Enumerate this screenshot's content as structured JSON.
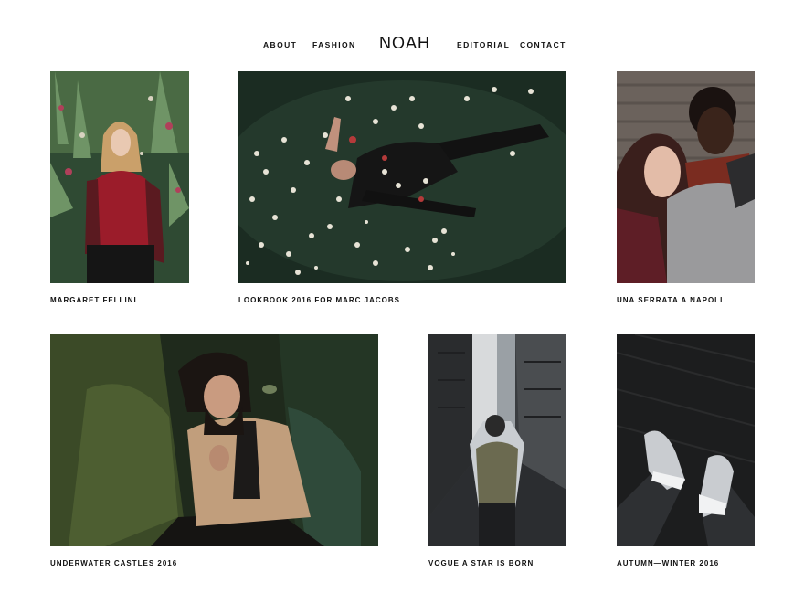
{
  "nav": {
    "items_left": [
      "ABOUT",
      "FASHION"
    ],
    "logo": "NOAH",
    "items_right": [
      "EDITORIAL",
      "CONTACT"
    ]
  },
  "gallery": [
    {
      "caption": "MARGARET FELLINI",
      "image": "woman-in-garden-photo"
    },
    {
      "caption": "LOOKBOOK 2016 FOR MARC JACOBS",
      "image": "woman-floating-in-flowers-photo"
    },
    {
      "caption": "UNA SERRATA A NAPOLI",
      "image": "two-women-portrait-photo"
    },
    {
      "caption": "UNDERWATER CASTLES 2016",
      "image": "bearded-man-in-forest-photo"
    },
    {
      "caption": "VOGUE A STAR IS BORN",
      "image": "backpacker-in-city-alley-photo"
    },
    {
      "caption": "AUTUMN—WINTER 2016",
      "image": "sneakers-feet-photo"
    }
  ]
}
